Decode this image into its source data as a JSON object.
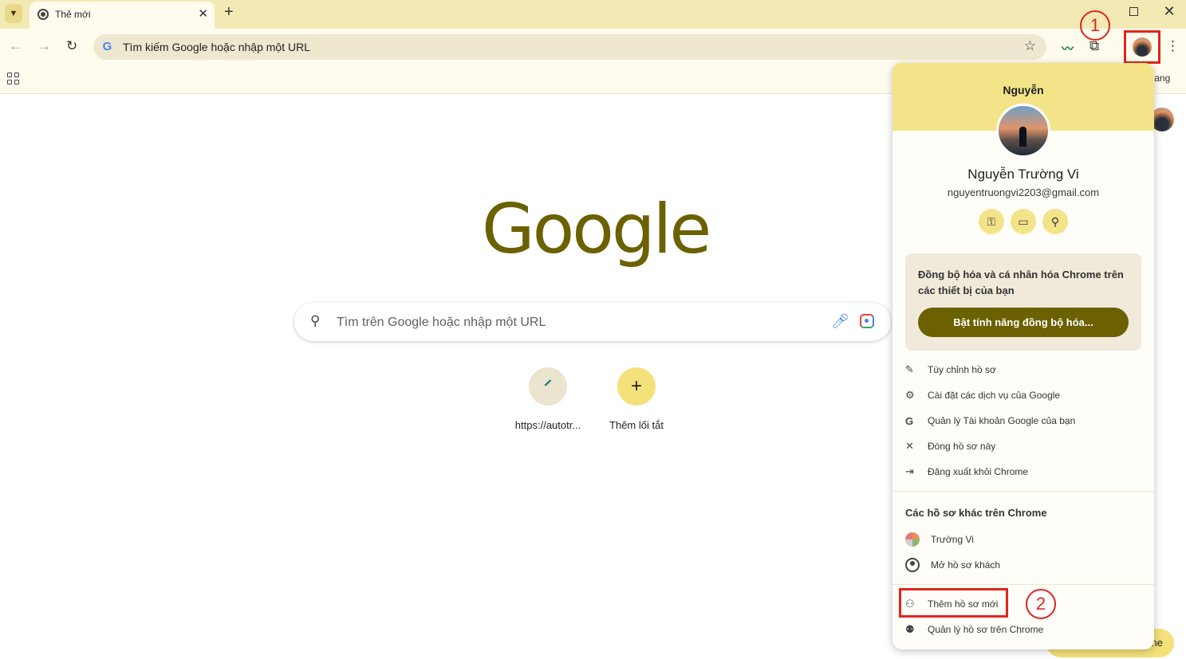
{
  "tabs": [
    {
      "title": "Thẻ mới"
    }
  ],
  "omnibox": {
    "text": "Tìm kiếm Google hoặc nhập một URL"
  },
  "bookmarks_bar": {
    "right_text": "trang"
  },
  "annotations": {
    "one": "1",
    "two": "2"
  },
  "page": {
    "logo_text": "Google",
    "search_placeholder": "Tìm trên Google hoặc nhập một URL",
    "shortcuts": [
      {
        "label": "https://autotr..."
      },
      {
        "label": "Thêm lối tắt"
      }
    ],
    "customize_label": "ne"
  },
  "profile_panel": {
    "header_name": "Nguyễn",
    "full_name": "Nguyễn Trường Vi",
    "email": "nguyentruongvi2203@gmail.com",
    "sync": {
      "text": "Đồng bộ hóa và cá nhân hóa Chrome trên các thiết bị của bạn",
      "button": "Bật tính năng đồng bộ hóa..."
    },
    "menu": [
      {
        "label": "Tùy chỉnh hồ sơ",
        "icon": "pencil-icon"
      },
      {
        "label": "Cài đặt các dịch vụ của Google",
        "icon": "gear-icon"
      },
      {
        "label": "Quản lý Tài khoản Google của bạn",
        "icon": "google-g-icon"
      },
      {
        "label": "Đóng hồ sơ này",
        "icon": "close-icon"
      },
      {
        "label": "Đăng xuất khỏi Chrome",
        "icon": "sign-out-icon"
      }
    ],
    "other_profiles_title": "Các hồ sơ khác trên Chrome",
    "other_profiles": [
      {
        "label": "Trường Vi"
      },
      {
        "label": "Mở hồ sơ khách"
      }
    ],
    "footer": [
      {
        "label": "Thêm hồ sơ mới",
        "icon": "add-person-icon"
      },
      {
        "label": "Quản lý hồ sơ trên Chrome",
        "icon": "manage-profiles-icon"
      }
    ]
  },
  "colors": {
    "accent": "#6b6100",
    "header": "#f3e48a",
    "annotation": "#e1251b"
  }
}
